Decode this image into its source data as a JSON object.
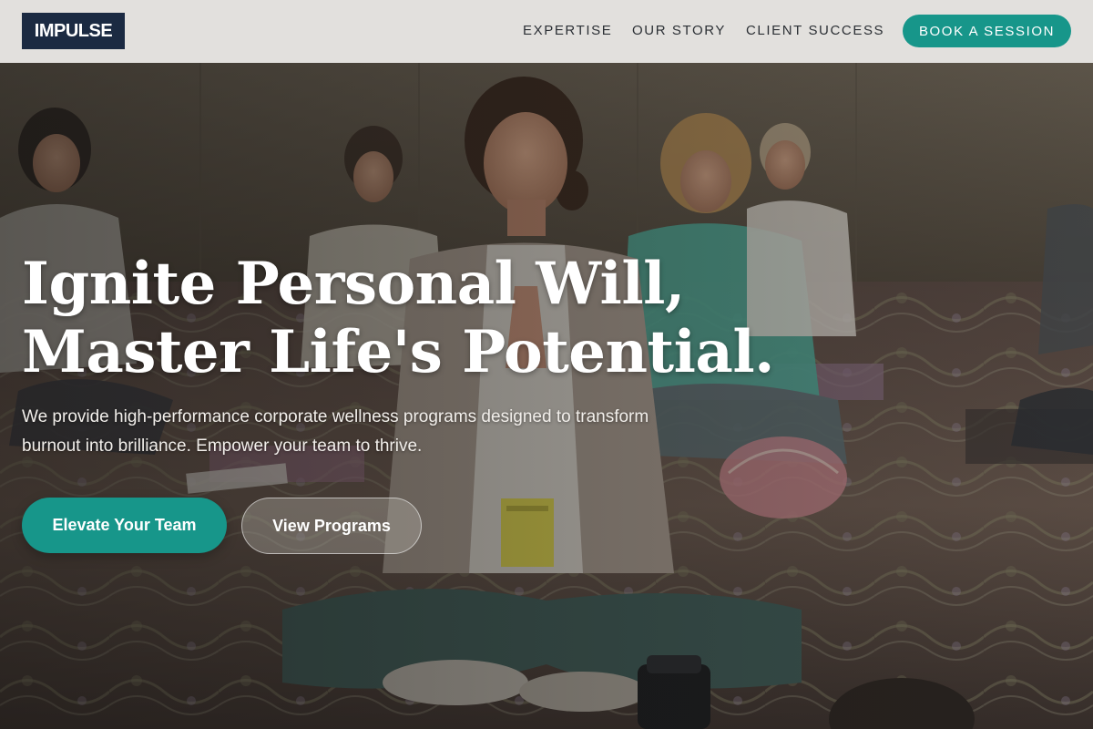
{
  "header": {
    "logo_text": "IMPULSE",
    "nav": [
      {
        "label": "EXPERTISE"
      },
      {
        "label": "OUR STORY"
      },
      {
        "label": "CLIENT SUCCESS"
      }
    ],
    "cta_label": "BOOK A SESSION"
  },
  "hero": {
    "headline_line1": "Ignite Personal Will,",
    "headline_line2": "Master Life's Potential.",
    "subtext": "We provide high-performance corporate wellness programs designed to transform burnout into brilliance. Empower your team to thrive.",
    "primary_cta": "Elevate Your Team",
    "secondary_cta": "View Programs",
    "image_description": "group-meditation-photo"
  },
  "colors": {
    "brand_navy": "#1b2a42",
    "accent_teal": "#17968a",
    "header_bg": "#e2e0dd",
    "nav_text": "#2c3035"
  }
}
